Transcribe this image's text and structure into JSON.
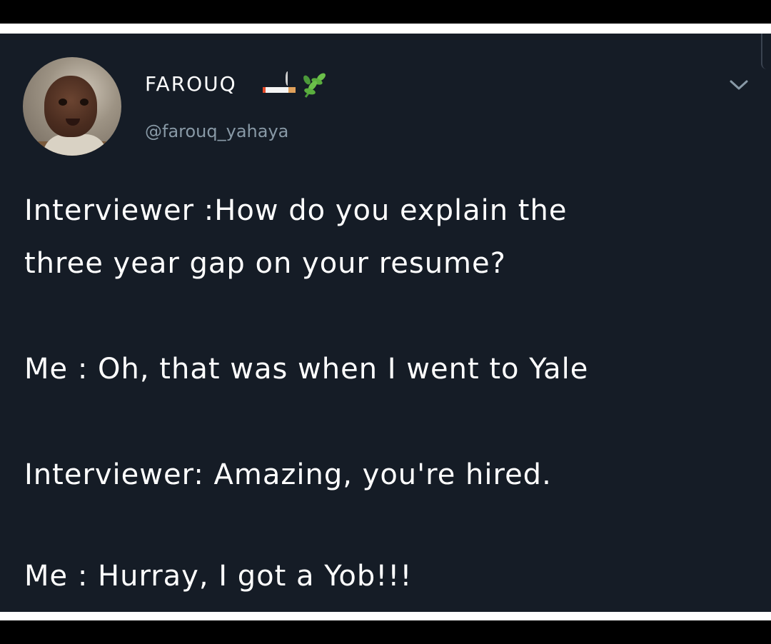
{
  "tweet": {
    "author": {
      "display_name": "FAROUQ",
      "name_emojis": [
        "cigarette-icon",
        "herb-icon"
      ],
      "handle": "@farouq_yahaya",
      "avatar": "avatar-photo"
    },
    "menu_icon": "chevron-down-icon",
    "lines": [
      "Interviewer :How do you explain the",
      "three year gap on your resume?",
      "Me : Oh, that was when I went to Yale",
      "Interviewer: Amazing, you're hired.",
      "Me : Hurray, I got a Yob!!!"
    ]
  },
  "colors": {
    "background": "#151c26",
    "text": "#ffffff",
    "handle": "#8899a6",
    "frame": "#000000"
  }
}
